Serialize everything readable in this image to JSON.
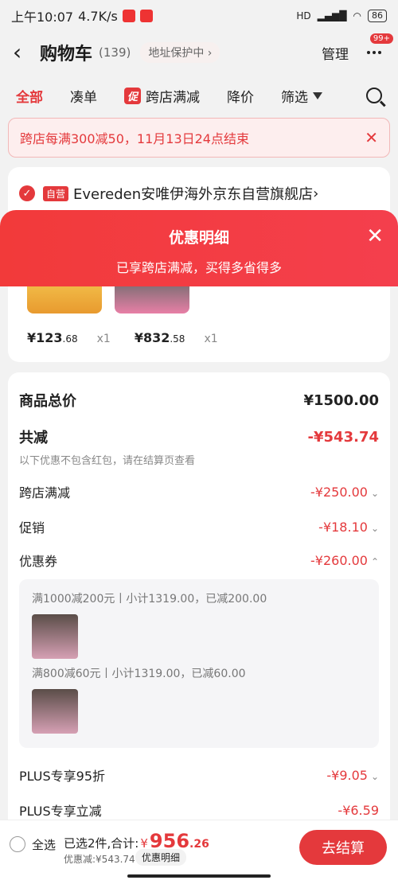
{
  "status": {
    "time": "上午10:07",
    "speed": "4.7K/s",
    "battery": "86",
    "signal": "HD"
  },
  "header": {
    "title": "购物车",
    "count": "(139)",
    "address": "地址保护中",
    "manage": "管理",
    "badge": "99+"
  },
  "tabs": [
    "全部",
    "凑单",
    "跨店满减",
    "降价",
    "筛选"
  ],
  "tab_promo_tag": "促",
  "notice": {
    "text": "跨店每满300减50，11月13日24点结束"
  },
  "store": {
    "self_tag": "自营",
    "name": "Evereden安唯伊海外京东自营旗舰店"
  },
  "products": [
    {
      "price_int": "¥123",
      "price_dec": ".68",
      "qty": "x1"
    },
    {
      "price_int": "¥832",
      "price_dec": ".58",
      "qty": "x1"
    }
  ],
  "overlay": {
    "title": "优惠明细",
    "subtitle": "已享跨店满减，买得多省得多"
  },
  "detail": {
    "total_label": "商品总价",
    "total_value": "¥1500.00",
    "reduce_label": "共减",
    "reduce_value": "-¥543.74",
    "note": "以下优惠不包含红包，请在结算页查看",
    "cross_label": "跨店满减",
    "cross_value": "-¥250.00",
    "promo_label": "促销",
    "promo_value": "-¥18.10",
    "coupon_label": "优惠券",
    "coupon_value": "-¥260.00",
    "coupon1": "满1000减200元丨小计1319.00，已减200.00",
    "coupon2": "满800减60元丨小计1319.00，已减60.00",
    "plus95_label": "PLUS专享95折",
    "plus95_value": "-¥9.05",
    "pluscut_label": "PLUS专享立减",
    "pluscut_value": "-¥6.59"
  },
  "bottom": {
    "select_all": "全选",
    "selected": "已选2件,合计:",
    "symbol": "¥",
    "total_int": "956",
    "total_dec": ".26",
    "discount": "优惠减:¥543.74",
    "discount_btn": "优惠明细",
    "checkout": "去结算"
  }
}
